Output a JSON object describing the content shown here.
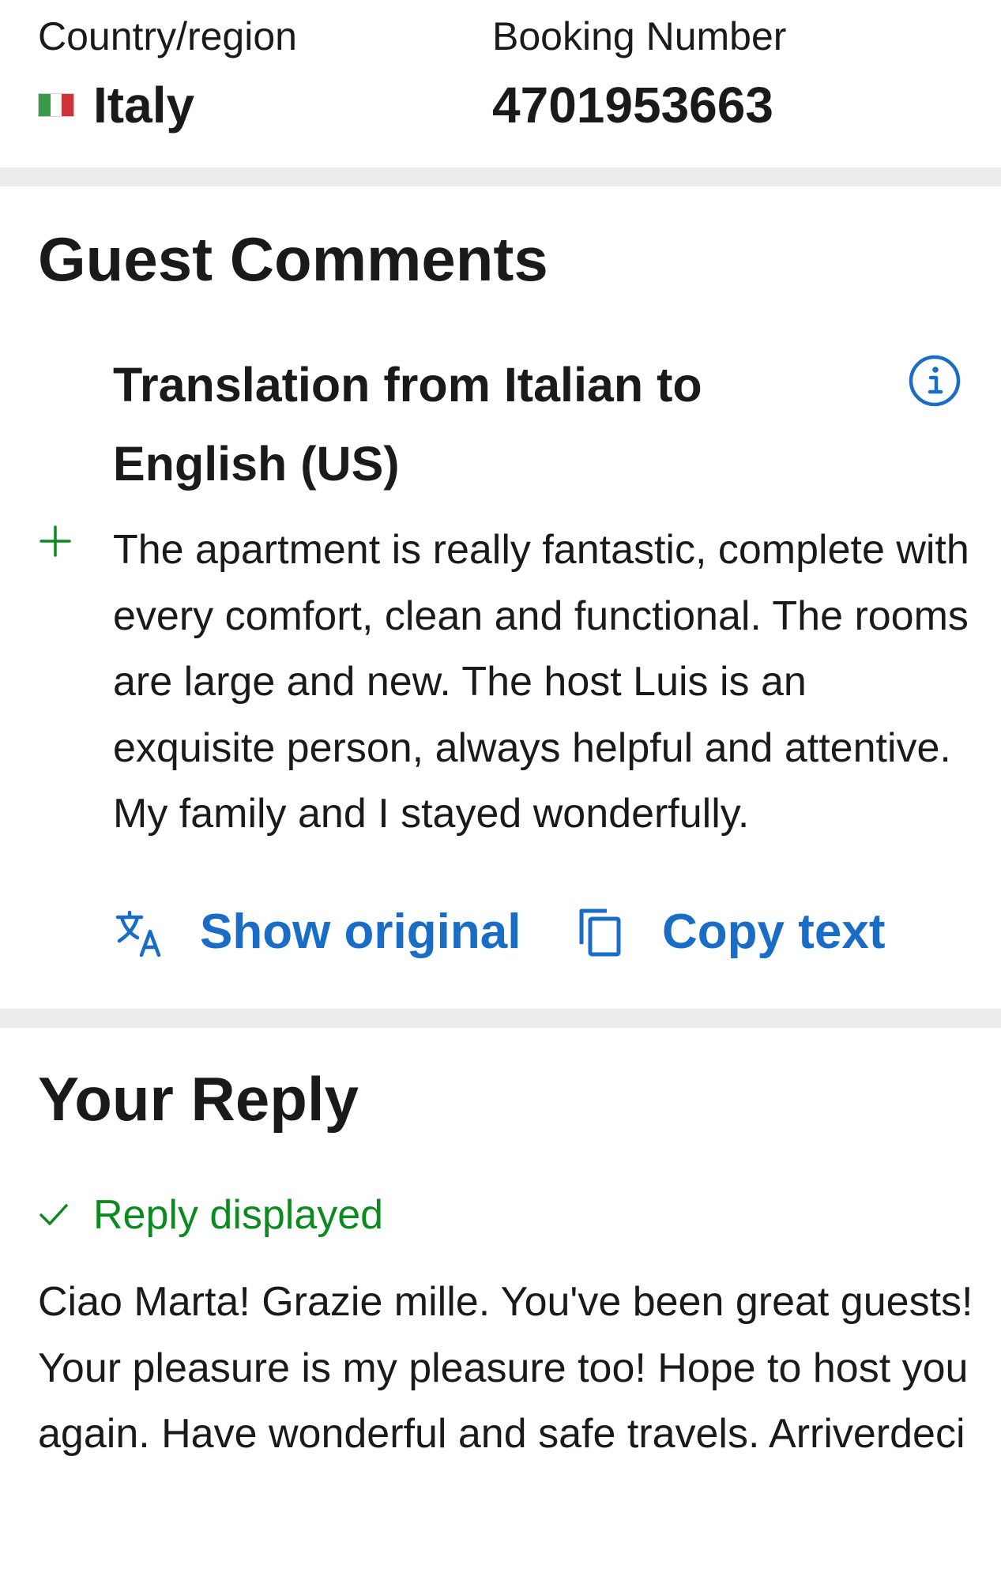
{
  "details": {
    "country_label": "Country/region",
    "country_value": "Italy",
    "country_flag": "italy-flag",
    "booking_label": "Booking Number",
    "booking_value": "4701953663"
  },
  "guest_comments": {
    "title": "Guest Comments",
    "translation_title": "Translation from Italian to English (US)",
    "info_icon": "info-icon",
    "positive_icon": "plus-icon",
    "comment": "The apartment is really fantastic, complete with every comfort, clean and functional. The rooms are large and new. The host Luis is an exquisite person, always helpful and attentive. My family and I stayed wonderfully.",
    "actions": {
      "show_original": {
        "label": "Show original",
        "icon": "translate-icon"
      },
      "copy_text": {
        "label": "Copy text",
        "icon": "copy-icon"
      }
    }
  },
  "reply": {
    "title": "Your Reply",
    "status_icon": "checkmark-icon",
    "status": "Reply displayed",
    "text": "Ciao Marta! Grazie mille. You've been great guests! Your pleasure is my pleasure too! Hope to host you again. Have wonderful and safe travels. Arriverdeci"
  },
  "colors": {
    "link_blue": "#1a6dc7",
    "success_green": "#0d8a1f",
    "divider_gray": "#ececec",
    "text": "#1a1a1a",
    "flag_green": "#3a9b46",
    "flag_white": "#ffffff",
    "flag_red": "#cf3238"
  }
}
